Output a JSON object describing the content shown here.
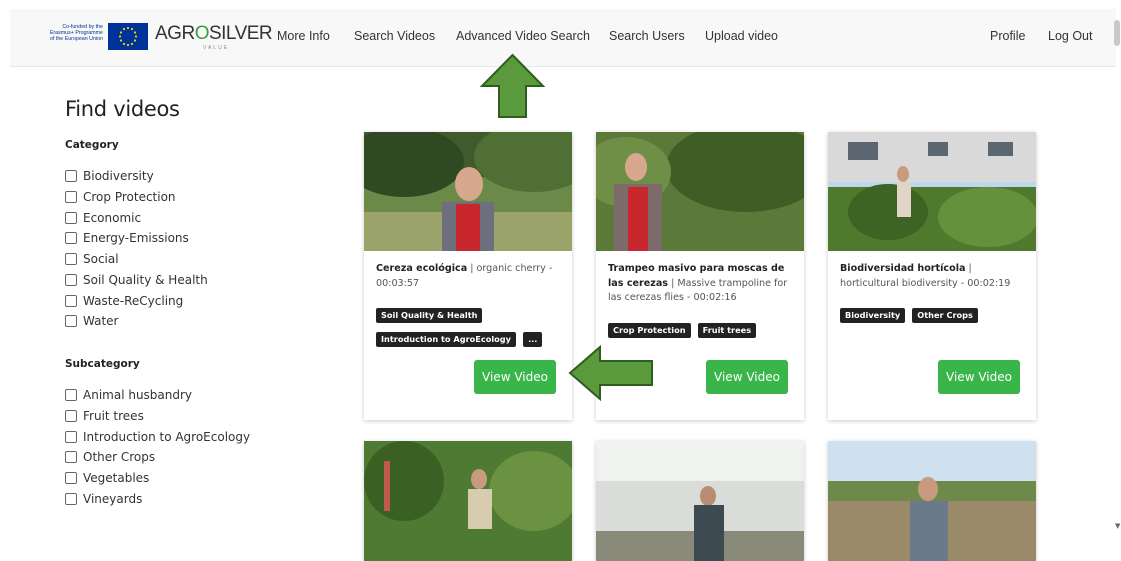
{
  "header": {
    "eu_text": [
      "Co-funded by the",
      "Erasmus+ Programme",
      "of the European Union"
    ],
    "brand_part1": "AGR",
    "brand_part2": "O",
    "brand_part3": "SILVER",
    "brand_sub": "VALUE",
    "nav": [
      "More Info",
      "Search Videos",
      "Advanced Video Search",
      "Search Users",
      "Upload video"
    ],
    "profile": "Profile",
    "logout": "Log Out"
  },
  "page": {
    "title": "Find videos",
    "category_heading": "Category",
    "categories": [
      "Biodiversity",
      "Crop Protection",
      "Economic",
      "Energy-Emissions",
      "Social",
      "Soil Quality & Health",
      "Waste-ReCycling",
      "Water"
    ],
    "subcategory_heading": "Subcategory",
    "subcategories": [
      "Animal husbandry",
      "Fruit trees",
      "Introduction to AgroEcology",
      "Other Crops",
      "Vegetables",
      "Vineyards"
    ]
  },
  "videos": [
    {
      "title_bold": "Cereza ecológica",
      "title_rest": " | organic cherry - 00:03:57",
      "tags": [
        "Soil Quality & Health",
        "Introduction to AgroEcology",
        "..."
      ],
      "button": "View Video"
    },
    {
      "title_bold": "Trampeo masivo para moscas de las cerezas",
      "title_rest": " | Massive trampoline for las cerezas flies - 00:02:16",
      "tags": [
        "Crop Protection",
        "Fruit trees"
      ],
      "button": "View Video"
    },
    {
      "title_bold": "Biodiversidad hortícola",
      "title_rest": " | horticultural biodiversity - 00:02:19",
      "tags": [
        "Biodiversity",
        "Other Crops"
      ],
      "button": "View Video"
    }
  ],
  "colors": {
    "accent_green": "#3ab54a",
    "tag_bg": "#222222",
    "annotation_arrow": "#5b9a3c"
  }
}
